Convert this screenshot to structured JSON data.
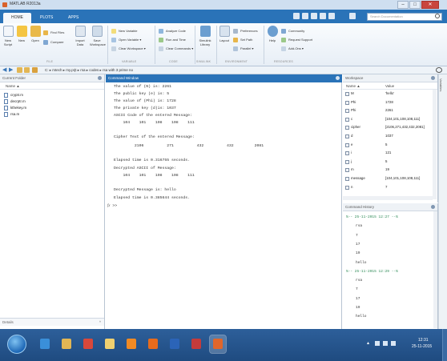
{
  "window": {
    "title": "MATLAB R2013a"
  },
  "tabs": [
    {
      "label": "HOME"
    },
    {
      "label": "PLOTS"
    },
    {
      "label": "APPS"
    }
  ],
  "search": {
    "placeholder": "Search Documentation"
  },
  "ribbon": {
    "new_script": "New Script",
    "new": "New",
    "open": "Open",
    "find_files": "Find Files",
    "compare": "Compare",
    "import_data": "Import Data",
    "save_workspace": "Save Workspace",
    "new_variable": "New Variable",
    "open_variable": "Open Variable ▾",
    "clear_workspace": "Clear Workspace ▾",
    "analyze_code": "Analyze Code",
    "run_and_time": "Run and Time",
    "clear_commands": "Clear Commands ▾",
    "simulink_library": "Simulink Library",
    "layout": "Layout",
    "preferences": "Preferences",
    "set_path": "Set Path",
    "parallel": "Parallel ▾",
    "help": "Help",
    "community": "Community",
    "request_support": "Request Support",
    "add_ons": "Add-Ons ▾",
    "groups": [
      "FILE",
      "VARIABLE",
      "CODE",
      "SIMULINK",
      "ENVIRONMENT",
      "RESOURCES"
    ]
  },
  "path": {
    "segments": [
      "C:",
      "mtech",
      "my.prjt",
      "rsa",
      "codes",
      "rsa with 3 prime no"
    ]
  },
  "current_folder": {
    "title": "Current Folder",
    "column": "Name ▲",
    "files": [
      "cryptr.m",
      "decrptr.m",
      "kthekey.m",
      "rsa.m"
    ],
    "details": "Details"
  },
  "command_window": {
    "title": "Command Window",
    "lines": [
      "The value of (N) is: 2261",
      "The public key (e) is: 5",
      "The value of (Phi) is: 1728",
      "The private key (d)is: 1037",
      "ASCII Code of the entered Message:",
      "    104    101    108    108    111",
      "",
      "Cipher Text of the entered Message:",
      "         2106          271          432          432         2081",
      "",
      "Elapsed time is 0.316755 seconds.",
      "Decrypted ASCII of Message:",
      "    104    101    108    108    111",
      "",
      "Decrypted Message is: hello",
      "Elapsed time is 0.385644 seconds."
    ],
    "prompt": ">> ",
    "prompt_glyph": "fx"
  },
  "workspace": {
    "title": "Workspace",
    "col_name": "Name ▲",
    "col_value": "Value",
    "vars": [
      {
        "name": "M",
        "value": "'hello'"
      },
      {
        "name": "Phi",
        "value": "1728"
      },
      {
        "name": "Phi",
        "value": "2261"
      },
      {
        "name": "c",
        "value": "[104,101,108,108,111]"
      },
      {
        "name": "cipher",
        "value": "[2106,271,432,432,2081]"
      },
      {
        "name": "d",
        "value": "1037"
      },
      {
        "name": "e",
        "value": "5"
      },
      {
        "name": "i",
        "value": "121"
      },
      {
        "name": "j",
        "value": "5"
      },
      {
        "name": "m",
        "value": "19"
      },
      {
        "name": "message",
        "value": "[104,101,108,108,111]"
      },
      {
        "name": "n",
        "value": "7"
      }
    ]
  },
  "history": {
    "title": "Command History",
    "entries": [
      {
        "kind": "session",
        "text": "%-- 25-11-2015 12:27 --%"
      },
      {
        "kind": "cmd",
        "text": "rsa"
      },
      {
        "kind": "cmd",
        "text": "7"
      },
      {
        "kind": "cmd",
        "text": "17"
      },
      {
        "kind": "cmd",
        "text": "19"
      },
      {
        "kind": "cmd",
        "text": "hello"
      },
      {
        "kind": "session",
        "text": "%-- 25-11-2015 12:29 --%"
      },
      {
        "kind": "cmd",
        "text": "rsa"
      },
      {
        "kind": "cmd",
        "text": "7"
      },
      {
        "kind": "cmd",
        "text": "17"
      },
      {
        "kind": "cmd",
        "text": "19"
      },
      {
        "kind": "cmd",
        "text": "hello"
      }
    ]
  },
  "side_tab": {
    "label": "Variables"
  },
  "taskbar": {
    "apps": [
      "ie-icon",
      "folder-icon",
      "chrome-icon",
      "files-icon",
      "user-icon",
      "firefox-icon",
      "word-icon",
      "media-icon",
      "matlab-icon"
    ],
    "time": "12:31",
    "date": "25-11-2015"
  },
  "colors": {
    "accent": "#2a73b8",
    "taskbar": "#2d5f9a",
    "history_session": "#2e8b57"
  }
}
